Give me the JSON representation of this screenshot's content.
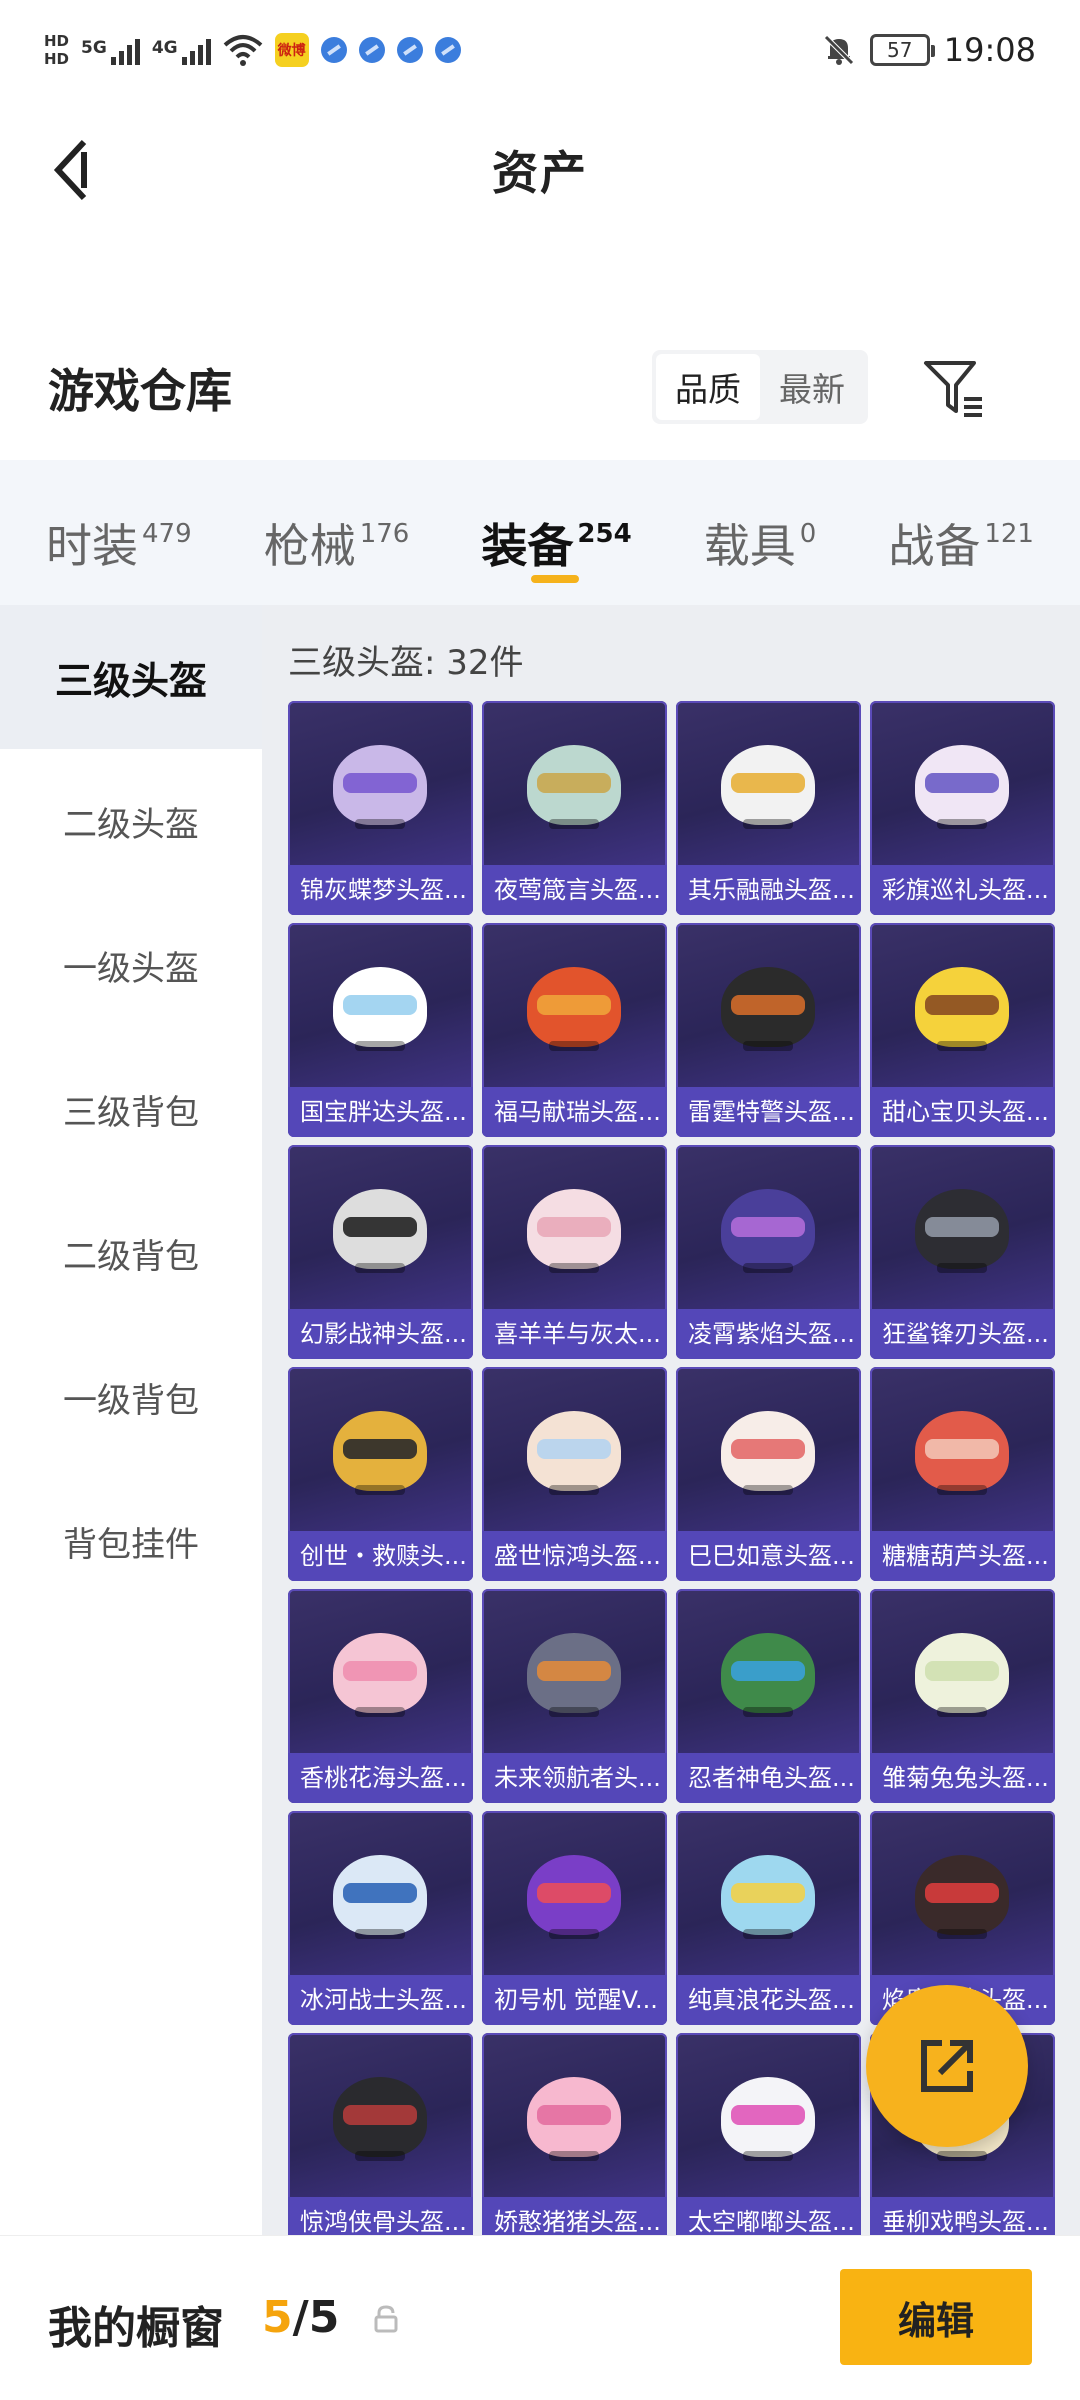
{
  "status_bar": {
    "left_text": [
      "HD",
      "5G",
      "4G"
    ],
    "app_icon_text": "微博",
    "battery": "57",
    "time": "19:08"
  },
  "nav": {
    "title": "资产"
  },
  "warehouse": {
    "title": "游戏仓库",
    "sort_options": [
      "品质",
      "最新"
    ],
    "active_sort": 0
  },
  "tabs": [
    {
      "label": "时装",
      "count": "479"
    },
    {
      "label": "枪械",
      "count": "176"
    },
    {
      "label": "装备",
      "count": "254"
    },
    {
      "label": "载具",
      "count": "0"
    },
    {
      "label": "战备",
      "count": "121"
    }
  ],
  "active_tab": 2,
  "categories": [
    "三级头盔",
    "二级头盔",
    "一级头盔",
    "三级背包",
    "二级背包",
    "一级背包",
    "背包挂件"
  ],
  "active_category": 0,
  "grid": {
    "header": "三级头盔: 32件",
    "items": [
      {
        "name": "锦灰蝶梦头盔...",
        "color": "#c9b8e8",
        "visor": "#7a5bd0"
      },
      {
        "name": "夜莺箴言头盔...",
        "color": "#bcd8cf",
        "visor": "#c9a84f"
      },
      {
        "name": "其乐融融头盔...",
        "color": "#f2f2f2",
        "visor": "#e8b03a"
      },
      {
        "name": "彩旗巡礼头盔...",
        "color": "#f0e6f5",
        "visor": "#6a5cc7"
      },
      {
        "name": "国宝胖达头盔...",
        "color": "#ffffff",
        "visor": "#9ad0f0"
      },
      {
        "name": "福马献瑞头盔...",
        "color": "#e2542c",
        "visor": "#f0a33a"
      },
      {
        "name": "雷霆特警头盔...",
        "color": "#2b2b2b",
        "visor": "#d06a2a"
      },
      {
        "name": "甜心宝贝头盔...",
        "color": "#f5d23b",
        "visor": "#8a4b22"
      },
      {
        "name": "幻影战神头盔...",
        "color": "#dddddd",
        "visor": "#222222"
      },
      {
        "name": "喜羊羊与灰太...",
        "color": "#f5dde3",
        "visor": "#e9a8b8"
      },
      {
        "name": "凌霄紫焰头盔...",
        "color": "#4a3f9a",
        "visor": "#b06bd8"
      },
      {
        "name": "狂鲨锋刃头盔...",
        "color": "#2d2d33",
        "visor": "#8f96a3"
      },
      {
        "name": "创世・救赎头...",
        "color": "#e4b13d",
        "visor": "#2a2a2a"
      },
      {
        "name": "盛世惊鸿头盔...",
        "color": "#f4e2d4",
        "visor": "#b5d4f0"
      },
      {
        "name": "巳巳如意头盔...",
        "color": "#f7ede8",
        "visor": "#e36a6a"
      },
      {
        "name": "糖糖葫芦头盔...",
        "color": "#e25b4a",
        "visor": "#f3c2b3"
      },
      {
        "name": "香桃花海头盔...",
        "color": "#f5c5d4",
        "visor": "#f08fb0"
      },
      {
        "name": "未来领航者头...",
        "color": "#6b6f86",
        "visor": "#e08a3c"
      },
      {
        "name": "忍者神龟头盔...",
        "color": "#3f8a4a",
        "visor": "#3aa0d8"
      },
      {
        "name": "雏菊兔兔头盔...",
        "color": "#eef2dc",
        "visor": "#cfe0b0"
      },
      {
        "name": "冰河战士头盔...",
        "color": "#dbe8f6",
        "visor": "#2f66b8"
      },
      {
        "name": "初号机 觉醒V...",
        "color": "#7a3ec7",
        "visor": "#e84c5c"
      },
      {
        "name": "纯真浪花头盔...",
        "color": "#9ed8ef",
        "visor": "#f1d24a"
      },
      {
        "name": "焰鹰忠魂头盔...",
        "color": "#3a2a2a",
        "visor": "#d83c3c"
      },
      {
        "name": "惊鸿侠骨头盔...",
        "color": "#2a2a2e",
        "visor": "#b03b3b"
      },
      {
        "name": "娇憨猪猪头盔...",
        "color": "#f7b8cf",
        "visor": "#e36fa0"
      },
      {
        "name": "太空嘟嘟头盔...",
        "color": "#f4f4f8",
        "visor": "#e056b8"
      },
      {
        "name": "垂柳戏鸭头盔...",
        "color": "#f2e6c6",
        "visor": "#e2a240"
      }
    ]
  },
  "bottom_bar": {
    "label": "我的橱窗",
    "current": "5",
    "separator": "/",
    "total": "5",
    "edit": "编辑"
  },
  "colors": {
    "accent": "#f5b21b",
    "card_label_bg": "#5447b8",
    "card_bg": "#2b2558"
  }
}
